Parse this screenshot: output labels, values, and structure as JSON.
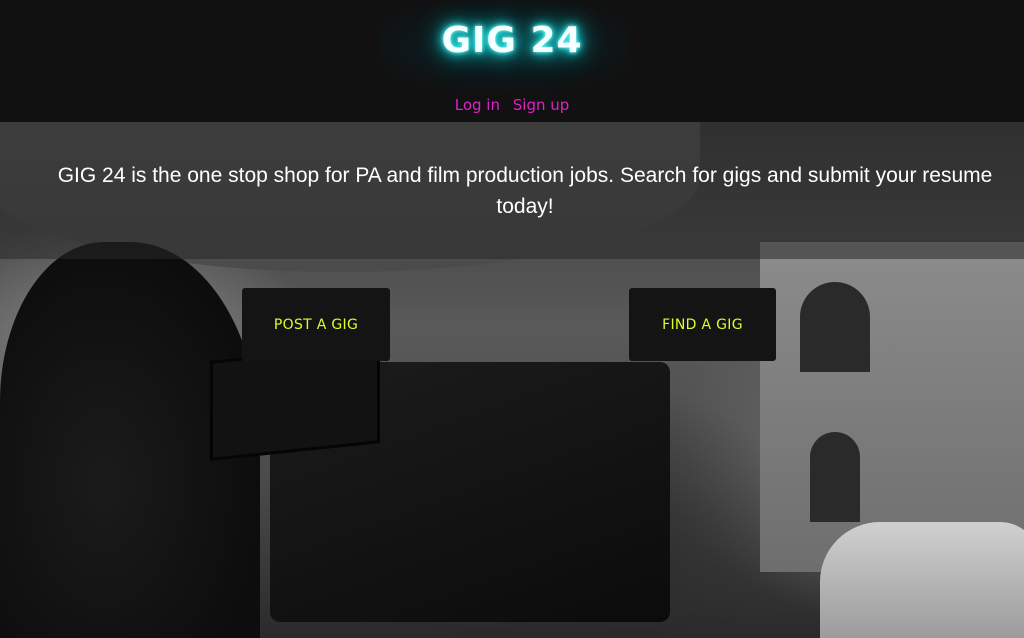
{
  "header": {
    "logo_text": "GIG 24",
    "nav": {
      "login_label": "Log in",
      "signup_label": "Sign up"
    }
  },
  "hero": {
    "tagline": "GIG 24 is the one stop shop for PA and film production jobs. Search for gigs and submit your resume today!",
    "buttons": {
      "post_gig_label": "POST A GIG",
      "find_gig_label": "FIND A GIG"
    },
    "background_image": "film-crew-camera-photo"
  },
  "colors": {
    "header_bg": "#111111",
    "logo_glow": "#22dddd",
    "nav_link": "#e020c8",
    "button_bg": "#141414",
    "button_text": "#d7ff2a"
  }
}
